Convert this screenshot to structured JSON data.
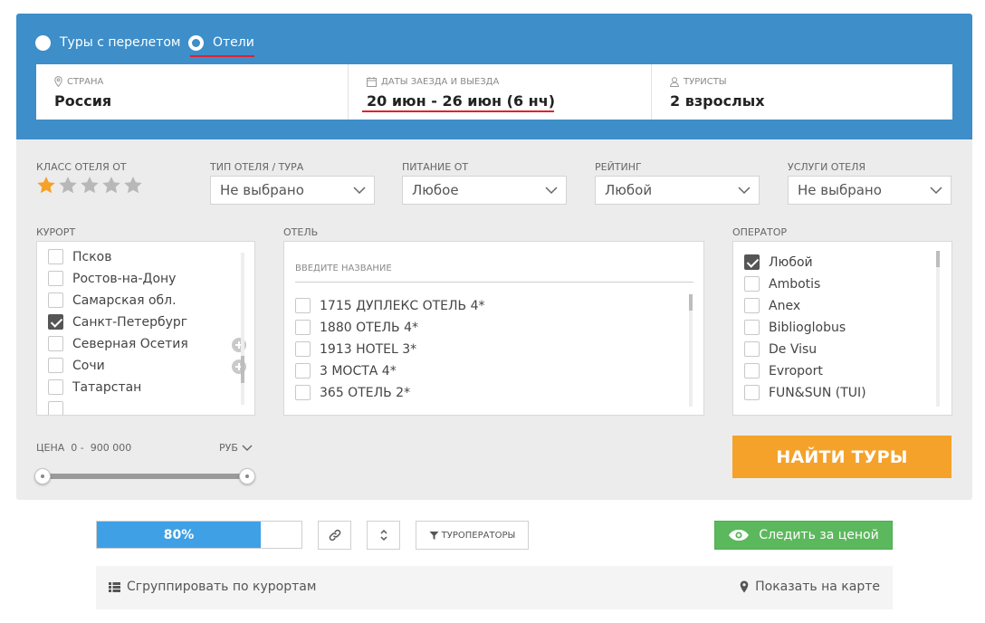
{
  "search": {
    "modes": [
      {
        "label": "Туры с перелетом",
        "selected": false
      },
      {
        "label": "Отели",
        "selected": true
      }
    ],
    "country": {
      "label": "Страна",
      "value": "Россия"
    },
    "dates": {
      "label": "Даты заезда и выезда",
      "value": "20 июн - 26 июн (6 нч)"
    },
    "tourists": {
      "label": "Туристы",
      "value": "2 взрослых"
    }
  },
  "filters": {
    "hotel_class": {
      "label": "Класс отеля от",
      "stars_selected": 1,
      "stars_total": 5
    },
    "hotel_type": {
      "label": "Тип отеля / тура",
      "value": "Не выбрано"
    },
    "meal": {
      "label": "Питание от",
      "value": "Любое"
    },
    "rating": {
      "label": "Рейтинг",
      "value": "Любой"
    },
    "services": {
      "label": "Услуги отеля",
      "value": "Не выбрано"
    },
    "resort": {
      "label": "Курорт",
      "items": [
        {
          "label": "Псков",
          "checked": false
        },
        {
          "label": "Ростов-на-Дону",
          "checked": false
        },
        {
          "label": "Самарская обл.",
          "checked": false
        },
        {
          "label": "Санкт-Петербург",
          "checked": true
        },
        {
          "label": "Северная Осетия",
          "checked": false
        },
        {
          "label": "Сочи",
          "checked": false
        },
        {
          "label": "Татарстан",
          "checked": false
        }
      ]
    },
    "hotel": {
      "label": "Отель",
      "placeholder": "Введите название",
      "items": [
        {
          "label": "1715 ДУПЛЕКС ОТЕЛЬ 4*",
          "checked": false
        },
        {
          "label": "1880 ОТЕЛЬ 4*",
          "checked": false
        },
        {
          "label": "1913 HOTEL 3*",
          "checked": false
        },
        {
          "label": "3 МОСТА 4*",
          "checked": false
        },
        {
          "label": "365 ОТЕЛЬ 2*",
          "checked": false
        }
      ]
    },
    "operator": {
      "label": "Оператор",
      "items": [
        {
          "label": "Любой",
          "checked": true
        },
        {
          "label": "Ambotis",
          "checked": false
        },
        {
          "label": "Anex",
          "checked": false
        },
        {
          "label": "Biblioglobus",
          "checked": false
        },
        {
          "label": "De Visu",
          "checked": false
        },
        {
          "label": "Evroport",
          "checked": false
        },
        {
          "label": "FUN&SUN (TUI)",
          "checked": false
        }
      ]
    },
    "price": {
      "label": "ЦЕНА",
      "min": "0",
      "max": "900 000",
      "currency": "РУБ",
      "range_fraction": [
        0,
        1
      ]
    },
    "search_button": "НАЙТИ ТУРЫ"
  },
  "toolbar": {
    "progress_text": "80%",
    "progress_value": 0.8,
    "operators_button": "ТУРОПЕРАТОРЫ",
    "follow_button": "Следить за ценой",
    "group_link": "Сгруппировать по курортам",
    "map_link": "Показать на карте"
  },
  "colors": {
    "header_blue": "#3d8ec9",
    "accent_red": "#e0222e",
    "star_active": "#f5a22a",
    "search_button": "#f5a22a",
    "progress": "#3fa0e5",
    "follow_button": "#5cb85c"
  }
}
